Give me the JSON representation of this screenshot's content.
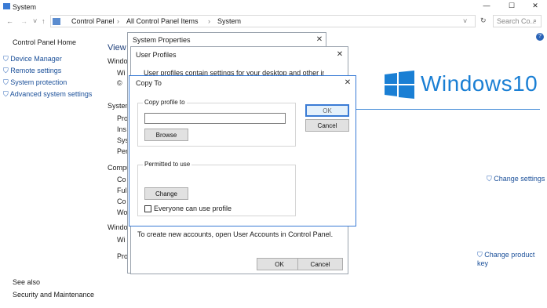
{
  "window": {
    "title": "System",
    "controls": {
      "minimize": "—",
      "maximize": "☐",
      "close": "✕"
    }
  },
  "address_bar": {
    "back": "←",
    "forward": "→",
    "up": "↑",
    "path": [
      "Control Panel",
      "All Control Panel Items",
      "System"
    ],
    "search_placeholder": "Search Co..."
  },
  "sidebar": {
    "home": "Control Panel Home",
    "items": [
      {
        "label": "Device Manager",
        "icon": "shield-icon"
      },
      {
        "label": "Remote settings",
        "icon": "shield-icon"
      },
      {
        "label": "System protection",
        "icon": "shield-icon"
      },
      {
        "label": "Advanced system settings",
        "icon": "shield-icon"
      }
    ],
    "see_also": "See also",
    "security_link": "Security and Maintenance"
  },
  "main": {
    "heading": "View",
    "sections": [
      {
        "title": "Windows",
        "rows": [
          "Wi",
          "©"
        ]
      },
      {
        "title": "System",
        "rows": [
          "Pro",
          "Ins",
          "Sys",
          "Pen"
        ]
      },
      {
        "title": "Compu",
        "rows": [
          "Co",
          "Ful",
          "Co",
          "Wo"
        ]
      },
      {
        "title": "Windows",
        "rows": [
          "Wi",
          "Pro"
        ]
      }
    ],
    "logo_text": "Windows10",
    "change_settings": "Change settings",
    "change_product_key": "Change product key"
  },
  "system_properties": {
    "title": "System Properties"
  },
  "user_profiles": {
    "title": "User Profiles",
    "intro": "User profiles contain settings for your desktop and other information",
    "footer": "To create new accounts, open User Accounts in Control Panel.",
    "ok": "OK",
    "cancel": "Cancel"
  },
  "copy_to": {
    "title": "Copy To",
    "copy_group": "Copy profile to",
    "path_value": "",
    "browse": "Browse",
    "permitted_group": "Permitted to use",
    "change": "Change",
    "everyone_label": "Everyone can use profile",
    "everyone_checked": false,
    "ok": "OK",
    "cancel": "Cancel"
  }
}
